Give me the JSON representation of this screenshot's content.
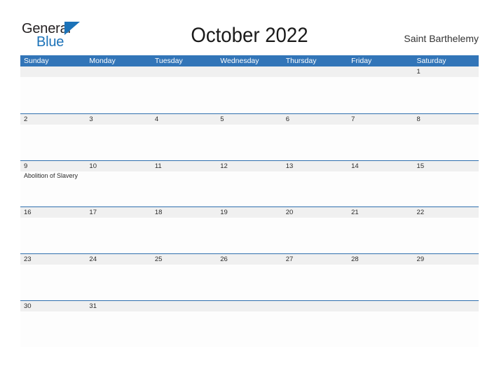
{
  "brand": {
    "name_part1": "General",
    "name_part2": "Blue",
    "accent_color": "#1b72b8"
  },
  "header": {
    "title": "October 2022",
    "location": "Saint Barthelemy"
  },
  "theme": {
    "header_blue": "#3275b8",
    "row_divider_blue": "#2f6fae",
    "date_band_gray": "#f0f0f0",
    "cell_background": "#fdfdfd",
    "text_color": "#2b2b2b"
  },
  "calendar": {
    "weekday_headers": [
      "Sunday",
      "Monday",
      "Tuesday",
      "Wednesday",
      "Thursday",
      "Friday",
      "Saturday"
    ],
    "weeks": [
      {
        "days": [
          {
            "num": "",
            "events": []
          },
          {
            "num": "",
            "events": []
          },
          {
            "num": "",
            "events": []
          },
          {
            "num": "",
            "events": []
          },
          {
            "num": "",
            "events": []
          },
          {
            "num": "",
            "events": []
          },
          {
            "num": "1",
            "events": []
          }
        ]
      },
      {
        "days": [
          {
            "num": "2",
            "events": []
          },
          {
            "num": "3",
            "events": []
          },
          {
            "num": "4",
            "events": []
          },
          {
            "num": "5",
            "events": []
          },
          {
            "num": "6",
            "events": []
          },
          {
            "num": "7",
            "events": []
          },
          {
            "num": "8",
            "events": []
          }
        ]
      },
      {
        "days": [
          {
            "num": "9",
            "events": [
              "Abolition of Slavery"
            ]
          },
          {
            "num": "10",
            "events": []
          },
          {
            "num": "11",
            "events": []
          },
          {
            "num": "12",
            "events": []
          },
          {
            "num": "13",
            "events": []
          },
          {
            "num": "14",
            "events": []
          },
          {
            "num": "15",
            "events": []
          }
        ]
      },
      {
        "days": [
          {
            "num": "16",
            "events": []
          },
          {
            "num": "17",
            "events": []
          },
          {
            "num": "18",
            "events": []
          },
          {
            "num": "19",
            "events": []
          },
          {
            "num": "20",
            "events": []
          },
          {
            "num": "21",
            "events": []
          },
          {
            "num": "22",
            "events": []
          }
        ]
      },
      {
        "days": [
          {
            "num": "23",
            "events": []
          },
          {
            "num": "24",
            "events": []
          },
          {
            "num": "25",
            "events": []
          },
          {
            "num": "26",
            "events": []
          },
          {
            "num": "27",
            "events": []
          },
          {
            "num": "28",
            "events": []
          },
          {
            "num": "29",
            "events": []
          }
        ]
      },
      {
        "days": [
          {
            "num": "30",
            "events": []
          },
          {
            "num": "31",
            "events": []
          },
          {
            "num": "",
            "events": []
          },
          {
            "num": "",
            "events": []
          },
          {
            "num": "",
            "events": []
          },
          {
            "num": "",
            "events": []
          },
          {
            "num": "",
            "events": []
          }
        ]
      }
    ]
  }
}
